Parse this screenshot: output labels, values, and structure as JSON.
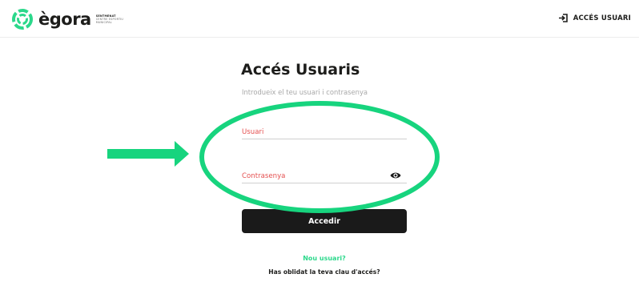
{
  "header": {
    "logo_name": "ègora",
    "logo_tagline": [
      "SENTMENAT",
      "CENTRE ESPORTIU",
      "MUNICIPAL"
    ],
    "login_label": "ACCÉS USUARI",
    "login_icon": "sign-in-icon"
  },
  "login": {
    "title": "Accés Usuaris",
    "subtitle": "Introdueix el teu usuari i contrasenya",
    "username_placeholder": "Usuari",
    "password_placeholder": "Contrasenya",
    "password_toggle_icon": "eye-icon",
    "submit_label": "Accedir",
    "new_user_label": "Nou usuari?",
    "forgot_label": "Has oblidat la teva clau d'accés?"
  },
  "colors": {
    "brand_green": "#2bd88b",
    "annotation_green": "#17d47e",
    "placeholder_red": "#e55050",
    "button_dark": "#1a1a1a"
  }
}
